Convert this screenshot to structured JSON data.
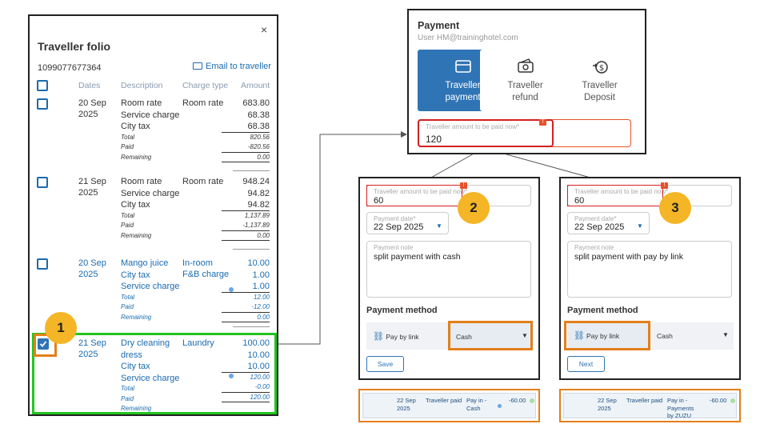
{
  "folio": {
    "title": "Traveller folio",
    "close_icon": "×",
    "folio_number": "1099077677364",
    "email_label": "Email to traveller",
    "headers": {
      "dates": "Dates",
      "description": "Description",
      "charge_type": "Charge type",
      "amount": "Amount"
    },
    "rows": [
      {
        "date_line1": "20 Sep",
        "date_line2": "2025",
        "descriptions": [
          "Room rate",
          "Service charge",
          "City tax"
        ],
        "charge_type": "Room rate",
        "amounts": [
          "683.80",
          "68.38",
          "68.38"
        ],
        "summary_labels": [
          "Total",
          "Paid",
          "Remaining"
        ],
        "summary_values": [
          "820.56",
          "-820.56",
          "0.00"
        ]
      },
      {
        "date_line1": "21 Sep",
        "date_line2": "2025",
        "descriptions": [
          "Room rate",
          "Service charge",
          "City tax"
        ],
        "charge_type": "Room rate",
        "amounts": [
          "948.24",
          "94.82",
          "94.82"
        ],
        "summary_labels": [
          "Total",
          "Paid",
          "Remaining"
        ],
        "summary_values": [
          "1,137.89",
          "-1,137.89",
          "0.00"
        ]
      },
      {
        "date_line1": "20 Sep",
        "date_line2": "2025",
        "descriptions": [
          "Mango juice",
          "City tax",
          "Service charge"
        ],
        "charge_type_line1": "In-room",
        "charge_type_line2": "F&B charge",
        "amounts": [
          "10.00",
          "1.00",
          "1.00"
        ],
        "summary_labels": [
          "Total",
          "Paid",
          "Remaining"
        ],
        "summary_values": [
          "12.00",
          "-12.00",
          "0.00"
        ]
      },
      {
        "date_line1": "21 Sep",
        "date_line2": "2025",
        "descriptions": [
          "Dry cleaning",
          "dress",
          "City tax",
          "Service charge"
        ],
        "charge_type": "Laundry",
        "amounts": [
          "100.00",
          "10.00",
          "10.00",
          "120.00"
        ],
        "summary_labels": [
          "Total",
          "Paid",
          "Remaining"
        ],
        "summary_values": [
          "-0.00",
          "120.00"
        ]
      }
    ]
  },
  "payment": {
    "title": "Payment",
    "user": "User HM@traininghotel.com",
    "tiles": [
      {
        "line1": "Traveller",
        "line2": "payment",
        "icon": "card-icon"
      },
      {
        "line1": "Traveller",
        "line2": "refund",
        "icon": "cash-refund-icon"
      },
      {
        "line1": "Traveller",
        "line2": "Deposit",
        "icon": "deposit-icon"
      }
    ],
    "amount_label": "Traveller amount to be paid now*",
    "amount_value": "120",
    "required_mark": "!"
  },
  "split_cash": {
    "amount_label": "Traveller amount to be paid now*",
    "amount_value": "60",
    "date_label": "Payment date*",
    "date_value": "22 Sep 2025",
    "note_label": "Payment note",
    "note_value": "split payment with cash",
    "method_title": "Payment method",
    "opt_link": "Pay by link",
    "opt_cash": "Cash",
    "button": "Save",
    "required_mark": "!"
  },
  "split_link": {
    "amount_label": "Traveller amount to be paid now*",
    "amount_value": "60",
    "date_label": "Payment date*",
    "date_value": "22 Sep 2025",
    "note_label": "Payment note",
    "note_value": "split payment with pay by link",
    "method_title": "Payment method",
    "opt_link": "Pay by link",
    "opt_cash": "Cash",
    "button": "Next",
    "required_mark": "!"
  },
  "steps": {
    "one": "1",
    "two": "2",
    "three": "3"
  },
  "strip_cash": {
    "date1": "22 Sep",
    "date2": "2025",
    "who": "Traveller paid",
    "how1": "Pay in -",
    "how2": "Cash",
    "amount": "-60.00"
  },
  "strip_link": {
    "date1": "22 Sep",
    "date2": "2025",
    "who": "Traveller paid",
    "how1": "Pay in -",
    "how2": "Payments",
    "how3": "by ZUZU",
    "amount": "-60.00"
  },
  "colors": {
    "accent": "#2f74b5",
    "highlight_orange": "#e37f1a",
    "highlight_green": "#22c51e",
    "step_badge": "#f4b526",
    "required_red": "#e8502a"
  }
}
